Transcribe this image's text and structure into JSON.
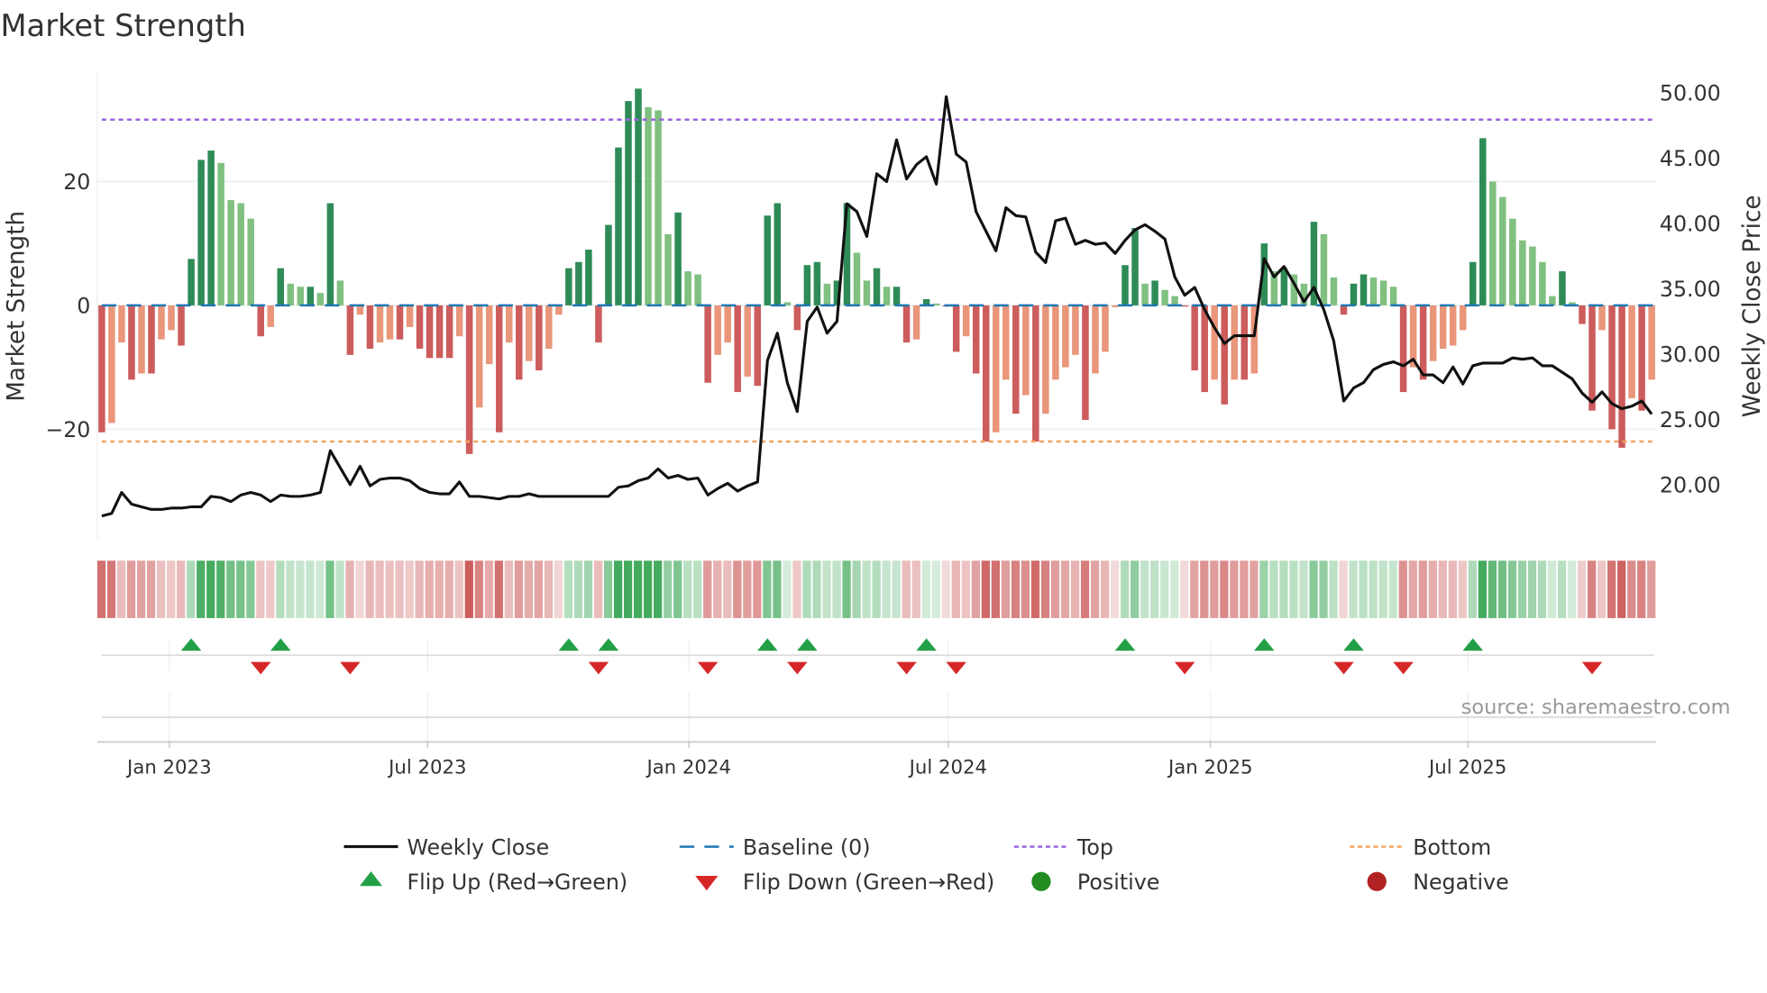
{
  "chart_data": {
    "type": "bar",
    "title": "Market Strength",
    "ylabel": "Market Strength",
    "ylabel_right": "Weekly Close Price",
    "ylim": [
      -37.6,
      37.5
    ],
    "ylim_right": [
      15.9,
      51.5
    ],
    "yticks": [
      {
        "v": 20,
        "label": "20"
      },
      {
        "v": 0,
        "label": "0"
      },
      {
        "v": -20,
        "label": "−20"
      }
    ],
    "yticks_right": [
      {
        "v": 50,
        "label": "50.00"
      },
      {
        "v": 45,
        "label": "45.00"
      },
      {
        "v": 40,
        "label": "40.00"
      },
      {
        "v": 35,
        "label": "35.00"
      },
      {
        "v": 30,
        "label": "30.00"
      },
      {
        "v": 25,
        "label": "25.00"
      },
      {
        "v": 20,
        "label": "20.00"
      }
    ],
    "xticks": [
      {
        "i": 6.8,
        "label": "Jan 2023"
      },
      {
        "i": 32.8,
        "label": "Jul 2023"
      },
      {
        "i": 59.1,
        "label": "Jan 2024"
      },
      {
        "i": 85.2,
        "label": "Jul 2024"
      },
      {
        "i": 111.6,
        "label": "Jan 2025"
      },
      {
        "i": 137.5,
        "label": "Jul 2025"
      }
    ],
    "top": 30,
    "bottom": -22,
    "strength": [
      -20.5,
      -19,
      -6,
      -12,
      -11,
      -11,
      -5.5,
      -4,
      -6.5,
      7.5,
      23.5,
      25,
      23,
      17,
      16.5,
      14,
      -5,
      -3.5,
      6,
      3.5,
      3,
      3,
      2,
      16.5,
      4,
      -8,
      -1.5,
      -7,
      -6,
      -5.5,
      -5.5,
      -3.5,
      -7,
      -8.5,
      -8.5,
      -8.5,
      -5,
      -24,
      -16.5,
      -9.5,
      -20.5,
      -6,
      -12,
      -9,
      -10.5,
      -7,
      -1.5,
      6,
      7,
      9,
      -6,
      13,
      25.5,
      33,
      35,
      32,
      31.5,
      11.5,
      15,
      5.5,
      5,
      -12.5,
      -8,
      -6,
      -14,
      -11.5,
      -13,
      14.5,
      16.5,
      0.5,
      -4,
      6.5,
      7,
      3.5,
      4,
      16.5,
      8.5,
      4,
      6,
      3,
      3,
      -6,
      -5.5,
      1,
      0.3,
      -0.2,
      -7.5,
      -5,
      -11,
      -22,
      -20.5,
      -12,
      -17.5,
      -14.5,
      -22,
      -17.5,
      -12,
      -10,
      -8,
      -18.5,
      -11,
      -7.5,
      -0.3,
      6.5,
      12.5,
      3.5,
      4,
      2.5,
      1.5,
      -0.2,
      -10.5,
      -14,
      -12,
      -16,
      -12,
      -12,
      -11,
      10,
      5.5,
      6,
      5,
      3.5,
      13.5,
      11.5,
      4.5,
      -1.5,
      3.5,
      5,
      4.5,
      4,
      3,
      -14,
      -10,
      -12,
      -9,
      -7,
      -6.5,
      -4,
      7,
      27,
      20,
      17.5,
      14,
      10.5,
      9.5,
      7,
      1.5,
      5.5,
      0.5,
      -3,
      -17,
      -4,
      -20,
      -23,
      -15,
      -17,
      -12
    ],
    "price": [
      17.6,
      17.8,
      19.4,
      18.5,
      18.3,
      18.1,
      18.1,
      18.2,
      18.2,
      18.3,
      18.3,
      19.1,
      19.0,
      18.7,
      19.2,
      19.4,
      19.2,
      18.7,
      19.2,
      19.1,
      19.1,
      19.2,
      19.4,
      22.6,
      21.3,
      20.0,
      21.4,
      19.9,
      20.4,
      20.5,
      20.5,
      20.3,
      19.7,
      19.4,
      19.3,
      19.3,
      20.2,
      19.1,
      19.1,
      19.0,
      18.9,
      19.1,
      19.1,
      19.3,
      19.1,
      19.1,
      19.1,
      19.1,
      19.1,
      19.1,
      19.1,
      19.1,
      19.8,
      19.9,
      20.3,
      20.5,
      21.2,
      20.5,
      20.7,
      20.4,
      20.5,
      19.2,
      19.7,
      20.1,
      19.5,
      19.9,
      20.2,
      29.5,
      31.6,
      27.8,
      25.6,
      32.5,
      33.6,
      31.6,
      32.5,
      41.5,
      40.9,
      39.0,
      43.8,
      43.2,
      46.4,
      43.4,
      44.5,
      45.1,
      43.0,
      49.7,
      45.3,
      44.7,
      40.9,
      39.4,
      37.9,
      41.2,
      40.6,
      40.5,
      37.8,
      37.0,
      40.2,
      40.4,
      38.4,
      38.7,
      38.4,
      38.5,
      37.7,
      38.7,
      39.5,
      39.9,
      39.4,
      38.8,
      35.9,
      34.5,
      35.1,
      33.4,
      32.0,
      30.8,
      31.4,
      31.4,
      31.4,
      37.3,
      35.9,
      36.7,
      35.4,
      34.0,
      35.1,
      33.4,
      31.0,
      26.4,
      27.4,
      27.8,
      28.8,
      29.2,
      29.4,
      29.1,
      29.6,
      28.4,
      28.4,
      27.8,
      29.0,
      27.7,
      29.1,
      29.3,
      29.3,
      29.3,
      29.7,
      29.6,
      29.7,
      29.1,
      29.1,
      28.6,
      28.1,
      27.0,
      26.3,
      27.1,
      26.2,
      25.8,
      26.0,
      26.4,
      25.4
    ],
    "flip_up": [
      9,
      18,
      47,
      51,
      67,
      71,
      83,
      103,
      117,
      126,
      138
    ],
    "flip_down": [
      16,
      25,
      50,
      61,
      70,
      81,
      86,
      109,
      125,
      131,
      150
    ],
    "legend": [
      {
        "key": "weekly_close",
        "label": "Weekly Close"
      },
      {
        "key": "baseline",
        "label": "Baseline (0)"
      },
      {
        "key": "top",
        "label": "Top"
      },
      {
        "key": "bottom",
        "label": "Bottom"
      },
      {
        "key": "flip_up",
        "label": "Flip Up (Red→Green)"
      },
      {
        "key": "flip_down",
        "label": "Flip Down (Green→Red)"
      },
      {
        "key": "positive",
        "label": "Positive"
      },
      {
        "key": "negative",
        "label": "Negative"
      }
    ],
    "colors": {
      "pos_up": "#2e8b57",
      "pos_down": "#80c080",
      "neg_down": "#cd5c5c",
      "neg_up": "#e9967a",
      "baseline": "#1f77b4",
      "top": "#9966dd",
      "bottom": "#f4a460",
      "price": "#111111",
      "flip_up": "#22a045",
      "flip_down": "#d62728",
      "positive": "#228b22",
      "negative": "#b22222"
    }
  },
  "source": "source: sharemaestro.com"
}
